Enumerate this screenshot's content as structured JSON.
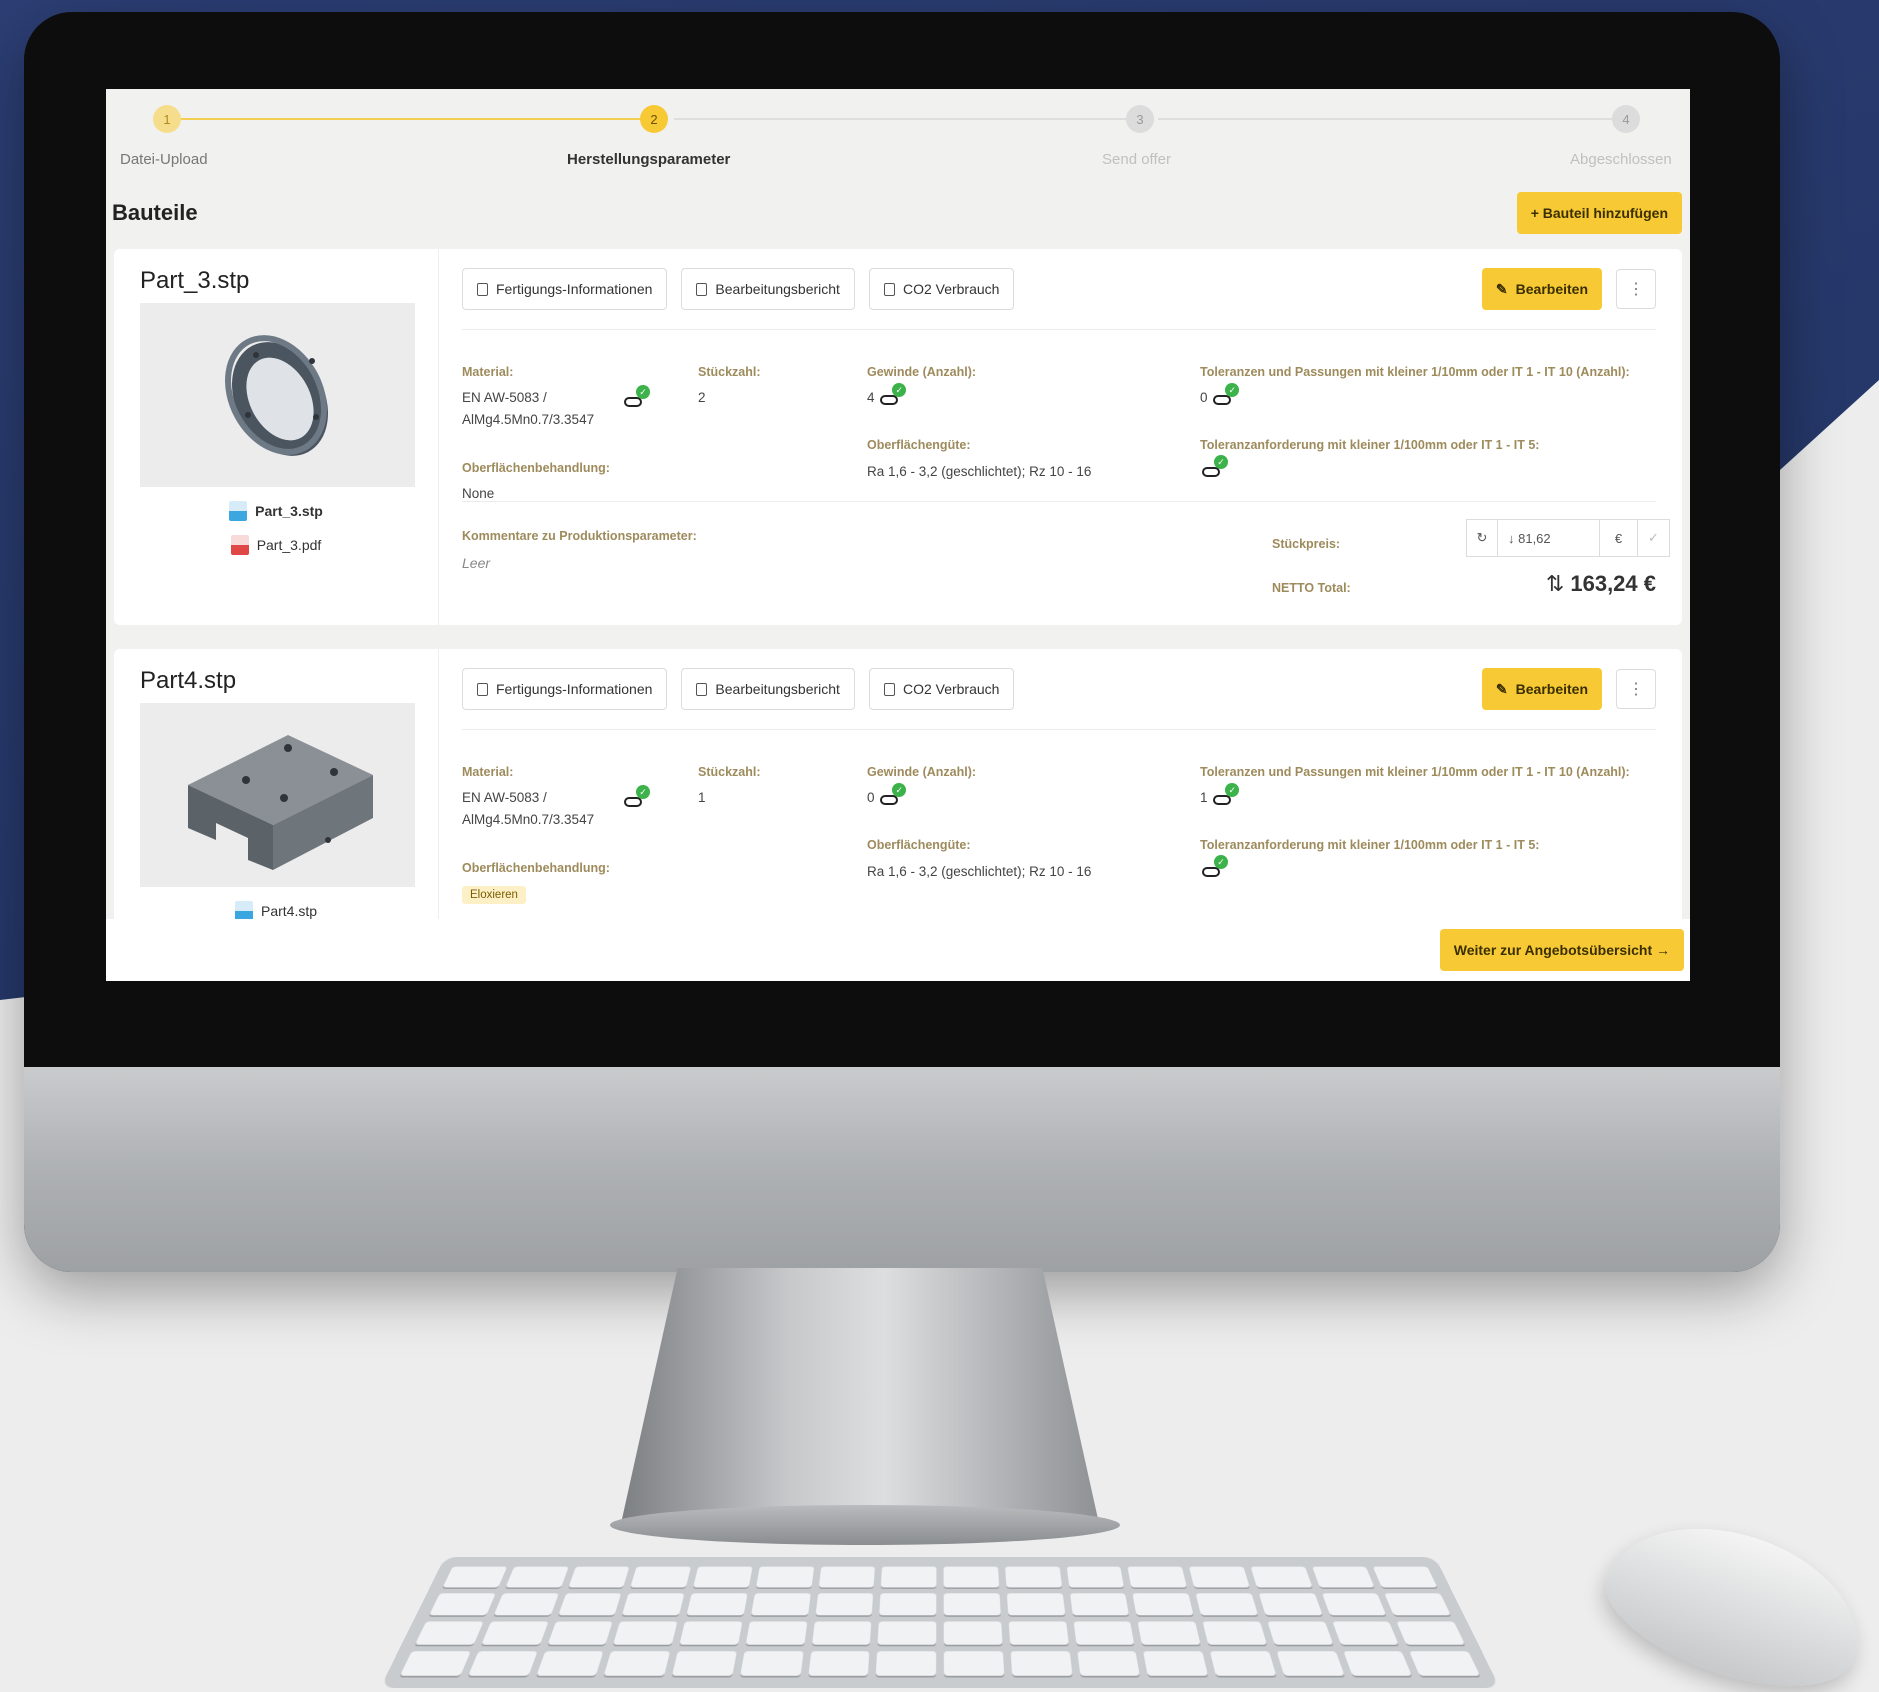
{
  "stepper": {
    "steps": [
      {
        "number": "1",
        "label": "Datei-Upload"
      },
      {
        "number": "2",
        "label": "Herstellungsparameter"
      },
      {
        "number": "3",
        "label": "Send offer"
      },
      {
        "number": "4",
        "label": "Abgeschlossen"
      }
    ],
    "active_step": 2
  },
  "page": {
    "title": "Bauteile",
    "add_button": "+ Bauteil hinzufügen"
  },
  "toolbar": {
    "fertigung": "Fertigungs-Informationen",
    "bericht": "Bearbeitungsbericht",
    "co2": "CO2 Verbrauch",
    "edit": "Bearbeiten",
    "more": "⋮"
  },
  "labels": {
    "material": "Material:",
    "stueckzahl": "Stückzahl:",
    "gewinde": "Gewinde (Anzahl):",
    "toleranzen": "Toleranzen und Passungen mit kleiner 1/10mm oder IT 1 - IT 10 (Anzahl):",
    "oberflaechenguete": "Oberflächengüte:",
    "toleranzanforderung": "Toleranzanforderung mit kleiner 1/100mm oder IT 1 - IT 5:",
    "oberflaechenbehandlung": "Oberflächenbehandlung:",
    "kommentare": "Kommentare zu Produktionsparameter:",
    "stueckpreis": "Stückpreis:",
    "netto": "NETTO Total:"
  },
  "parts": [
    {
      "name": "Part_3.stp",
      "files": [
        "Part_3.stp",
        "Part_3.pdf"
      ],
      "material_line1": "EN AW-5083 /",
      "material_line2": "AlMg4.5Mn0.7/3.3547",
      "stueckzahl": "2",
      "gewinde": "4",
      "toleranzen": "0",
      "oberflaechenguete": "Ra 1,6 - 3,2 (geschlichtet); Rz 10 - 16",
      "oberflaechenbehandlung": "None",
      "kommentar": "Leer",
      "stueckpreis": "↓ 81,62",
      "currency": "€",
      "netto_total": "163,24 €"
    },
    {
      "name": "Part4.stp",
      "files": [
        "Part4.stp"
      ],
      "material_line1": "EN AW-5083 /",
      "material_line2": "AlMg4.5Mn0.7/3.3547",
      "stueckzahl": "1",
      "gewinde": "0",
      "toleranzen": "1",
      "oberflaechenguete": "Ra 1,6 - 3,2 (geschlichtet); Rz 10 - 16",
      "oberflaechenbehandlung": "Eloxieren"
    }
  ],
  "footer": {
    "next_button": "Weiter zur Angebotsübersicht →"
  },
  "colors": {
    "accent": "#f6c935",
    "label": "#9e8b5c",
    "ok": "#3cb24a",
    "backdrop": "#26386a"
  }
}
